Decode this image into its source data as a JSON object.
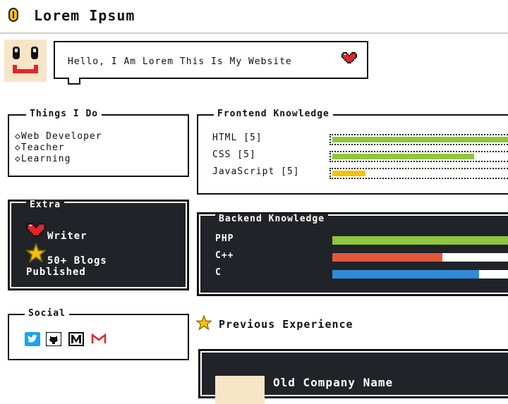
{
  "header": {
    "title": "Lorem Ipsum",
    "logo_icon": "coin-icon"
  },
  "intro": {
    "greeting": "Hello, I Am Lorem This Is My Website",
    "heart_icon": "heart-icon"
  },
  "things_i_do": {
    "title": "Things I Do",
    "items": [
      "Web Developer",
      "Teacher",
      "Learning"
    ]
  },
  "frontend": {
    "title": "Frontend Knowledge",
    "skills": [
      {
        "label": "HTML [5]",
        "level": 1.0,
        "color": "#8dc63f"
      },
      {
        "label": "CSS [5]",
        "level": 0.8,
        "color": "#8dc63f"
      },
      {
        "label": "JavaScript [5]",
        "level": 0.2,
        "color": "#f4c20d"
      }
    ]
  },
  "extra": {
    "title": "Extra",
    "writer": "Writer",
    "blogs_line1": "50+ Blogs",
    "blogs_line2": "Published"
  },
  "backend": {
    "title": "Backend Knowledge",
    "skills": [
      {
        "label": "PHP",
        "level": 1.0,
        "color": "#8dc63f"
      },
      {
        "label": "C++",
        "level": 0.6,
        "color": "#e2583e"
      },
      {
        "label": "C",
        "level": 0.8,
        "color": "#2e8bd9"
      }
    ]
  },
  "social": {
    "title": "Social",
    "icons": [
      "twitter-icon",
      "github-icon",
      "medium-icon",
      "gmail-icon"
    ]
  },
  "experience": {
    "title": "Previous Experience",
    "company": "Old Company Name"
  }
}
